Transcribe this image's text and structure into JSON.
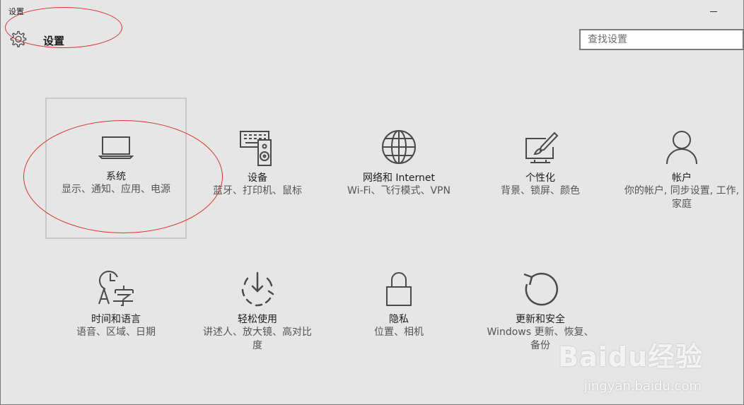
{
  "window": {
    "title": "设置"
  },
  "header": {
    "title": "设置",
    "gear_icon": "gear-icon"
  },
  "search": {
    "placeholder": "查找设置",
    "value": ""
  },
  "tiles": [
    {
      "name": "系统",
      "desc": "显示、通知、应用、电源",
      "icon": "laptop-icon",
      "selected": true
    },
    {
      "name": "设备",
      "desc": "蓝牙、打印机、鼠标",
      "icon": "devices-icon"
    },
    {
      "name": "网络和 Internet",
      "desc": "Wi-Fi、飞行模式、VPN",
      "icon": "globe-icon"
    },
    {
      "name": "个性化",
      "desc": "背景、锁屏、颜色",
      "icon": "paint-icon"
    },
    {
      "name": "帐户",
      "desc": "你的帐户, 同步设置, 工作, 家庭",
      "icon": "person-icon"
    },
    {
      "name": "时间和语言",
      "desc": "语音、区域、日期",
      "icon": "time-language-icon"
    },
    {
      "name": "轻松使用",
      "desc": "讲述人、放大镜、高对比度",
      "icon": "ease-of-access-icon"
    },
    {
      "name": "隐私",
      "desc": "位置、相机",
      "icon": "lock-icon"
    },
    {
      "name": "更新和安全",
      "desc": "Windows 更新、恢复、备份",
      "icon": "update-icon"
    }
  ],
  "watermark": {
    "brand": "Baidu经验",
    "url": "jingyan.baidu.com"
  },
  "colors": {
    "background": "#e6e6e6",
    "icon": "#4a4a4a",
    "annotation": "#d9352b"
  }
}
